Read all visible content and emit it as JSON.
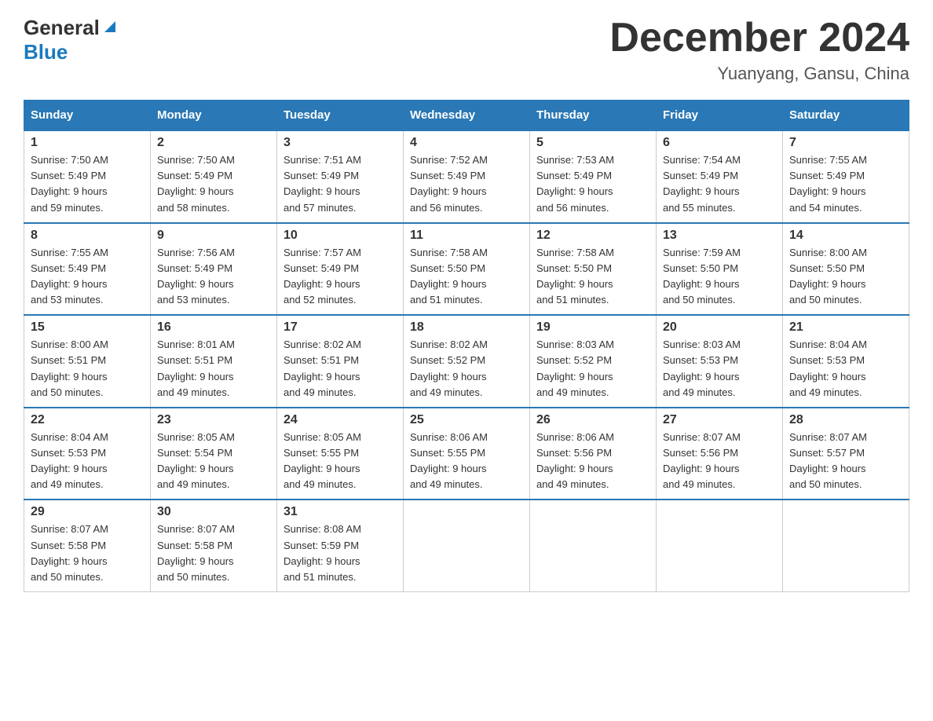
{
  "header": {
    "logo_general": "General",
    "logo_blue": "Blue",
    "month_year": "December 2024",
    "location": "Yuanyang, Gansu, China"
  },
  "days_of_week": [
    "Sunday",
    "Monday",
    "Tuesday",
    "Wednesday",
    "Thursday",
    "Friday",
    "Saturday"
  ],
  "weeks": [
    [
      {
        "day": "1",
        "sunrise": "7:50 AM",
        "sunset": "5:49 PM",
        "daylight": "9 hours and 59 minutes."
      },
      {
        "day": "2",
        "sunrise": "7:50 AM",
        "sunset": "5:49 PM",
        "daylight": "9 hours and 58 minutes."
      },
      {
        "day": "3",
        "sunrise": "7:51 AM",
        "sunset": "5:49 PM",
        "daylight": "9 hours and 57 minutes."
      },
      {
        "day": "4",
        "sunrise": "7:52 AM",
        "sunset": "5:49 PM",
        "daylight": "9 hours and 56 minutes."
      },
      {
        "day": "5",
        "sunrise": "7:53 AM",
        "sunset": "5:49 PM",
        "daylight": "9 hours and 56 minutes."
      },
      {
        "day": "6",
        "sunrise": "7:54 AM",
        "sunset": "5:49 PM",
        "daylight": "9 hours and 55 minutes."
      },
      {
        "day": "7",
        "sunrise": "7:55 AM",
        "sunset": "5:49 PM",
        "daylight": "9 hours and 54 minutes."
      }
    ],
    [
      {
        "day": "8",
        "sunrise": "7:55 AM",
        "sunset": "5:49 PM",
        "daylight": "9 hours and 53 minutes."
      },
      {
        "day": "9",
        "sunrise": "7:56 AM",
        "sunset": "5:49 PM",
        "daylight": "9 hours and 53 minutes."
      },
      {
        "day": "10",
        "sunrise": "7:57 AM",
        "sunset": "5:49 PM",
        "daylight": "9 hours and 52 minutes."
      },
      {
        "day": "11",
        "sunrise": "7:58 AM",
        "sunset": "5:50 PM",
        "daylight": "9 hours and 51 minutes."
      },
      {
        "day": "12",
        "sunrise": "7:58 AM",
        "sunset": "5:50 PM",
        "daylight": "9 hours and 51 minutes."
      },
      {
        "day": "13",
        "sunrise": "7:59 AM",
        "sunset": "5:50 PM",
        "daylight": "9 hours and 50 minutes."
      },
      {
        "day": "14",
        "sunrise": "8:00 AM",
        "sunset": "5:50 PM",
        "daylight": "9 hours and 50 minutes."
      }
    ],
    [
      {
        "day": "15",
        "sunrise": "8:00 AM",
        "sunset": "5:51 PM",
        "daylight": "9 hours and 50 minutes."
      },
      {
        "day": "16",
        "sunrise": "8:01 AM",
        "sunset": "5:51 PM",
        "daylight": "9 hours and 49 minutes."
      },
      {
        "day": "17",
        "sunrise": "8:02 AM",
        "sunset": "5:51 PM",
        "daylight": "9 hours and 49 minutes."
      },
      {
        "day": "18",
        "sunrise": "8:02 AM",
        "sunset": "5:52 PM",
        "daylight": "9 hours and 49 minutes."
      },
      {
        "day": "19",
        "sunrise": "8:03 AM",
        "sunset": "5:52 PM",
        "daylight": "9 hours and 49 minutes."
      },
      {
        "day": "20",
        "sunrise": "8:03 AM",
        "sunset": "5:53 PM",
        "daylight": "9 hours and 49 minutes."
      },
      {
        "day": "21",
        "sunrise": "8:04 AM",
        "sunset": "5:53 PM",
        "daylight": "9 hours and 49 minutes."
      }
    ],
    [
      {
        "day": "22",
        "sunrise": "8:04 AM",
        "sunset": "5:53 PM",
        "daylight": "9 hours and 49 minutes."
      },
      {
        "day": "23",
        "sunrise": "8:05 AM",
        "sunset": "5:54 PM",
        "daylight": "9 hours and 49 minutes."
      },
      {
        "day": "24",
        "sunrise": "8:05 AM",
        "sunset": "5:55 PM",
        "daylight": "9 hours and 49 minutes."
      },
      {
        "day": "25",
        "sunrise": "8:06 AM",
        "sunset": "5:55 PM",
        "daylight": "9 hours and 49 minutes."
      },
      {
        "day": "26",
        "sunrise": "8:06 AM",
        "sunset": "5:56 PM",
        "daylight": "9 hours and 49 minutes."
      },
      {
        "day": "27",
        "sunrise": "8:07 AM",
        "sunset": "5:56 PM",
        "daylight": "9 hours and 49 minutes."
      },
      {
        "day": "28",
        "sunrise": "8:07 AM",
        "sunset": "5:57 PM",
        "daylight": "9 hours and 50 minutes."
      }
    ],
    [
      {
        "day": "29",
        "sunrise": "8:07 AM",
        "sunset": "5:58 PM",
        "daylight": "9 hours and 50 minutes."
      },
      {
        "day": "30",
        "sunrise": "8:07 AM",
        "sunset": "5:58 PM",
        "daylight": "9 hours and 50 minutes."
      },
      {
        "day": "31",
        "sunrise": "8:08 AM",
        "sunset": "5:59 PM",
        "daylight": "9 hours and 51 minutes."
      },
      null,
      null,
      null,
      null
    ]
  ]
}
